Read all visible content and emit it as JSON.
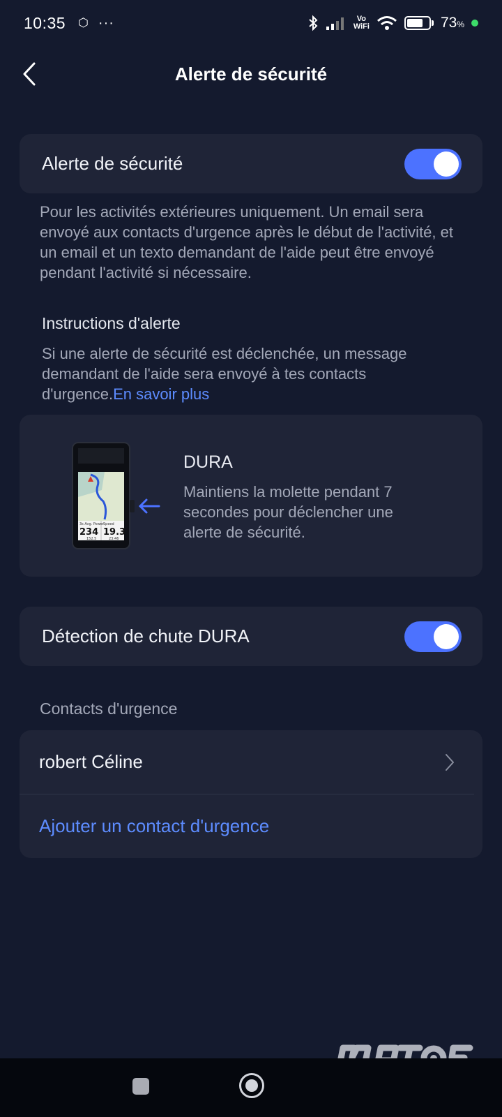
{
  "status_bar": {
    "time": "10:35",
    "volte_top": "Vo",
    "volte_bottom": "WiFi",
    "battery_percent": "73",
    "battery_percent_sign": "%",
    "battery_level": 0.73
  },
  "header": {
    "title": "Alerte de sécurité",
    "back_icon": "chevron-left-icon"
  },
  "safety_alert": {
    "label": "Alerte de sécurité",
    "enabled": true,
    "description": "Pour les activités extérieures uniquement. Un email sera envoyé aux contacts d'urgence après le début de l'activité, et un email et un texto demandant de l'aide peut être envoyé pendant l'activité si nécessaire."
  },
  "instructions": {
    "title": "Instructions d'alerte",
    "text": "Si une alerte de sécurité est déclenchée, un message demandant de l'aide sera envoyé à tes contacts d'urgence.",
    "link": "En savoir plus"
  },
  "device": {
    "name": "DURA",
    "description": "Maintiens la molette pendant 7 secondes pour déclencher une alerte de sécurité.",
    "screen_labels": [
      "3s Avg. Power",
      "Speed"
    ],
    "screen_values": [
      "234",
      "19.3"
    ],
    "screen_footer": [
      "152.5",
      "23:46"
    ]
  },
  "fall_detection": {
    "label": "Détection de chute DURA",
    "enabled": true
  },
  "contacts": {
    "section_title": "Contacts d'urgence",
    "items": [
      {
        "name": "robert Céline"
      }
    ],
    "add_label": "Ajouter un contact d'urgence"
  },
  "colors": {
    "background": "#141a2e",
    "card": "#1f2437",
    "accent": "#4c72ff",
    "link": "#5d8cff"
  }
}
